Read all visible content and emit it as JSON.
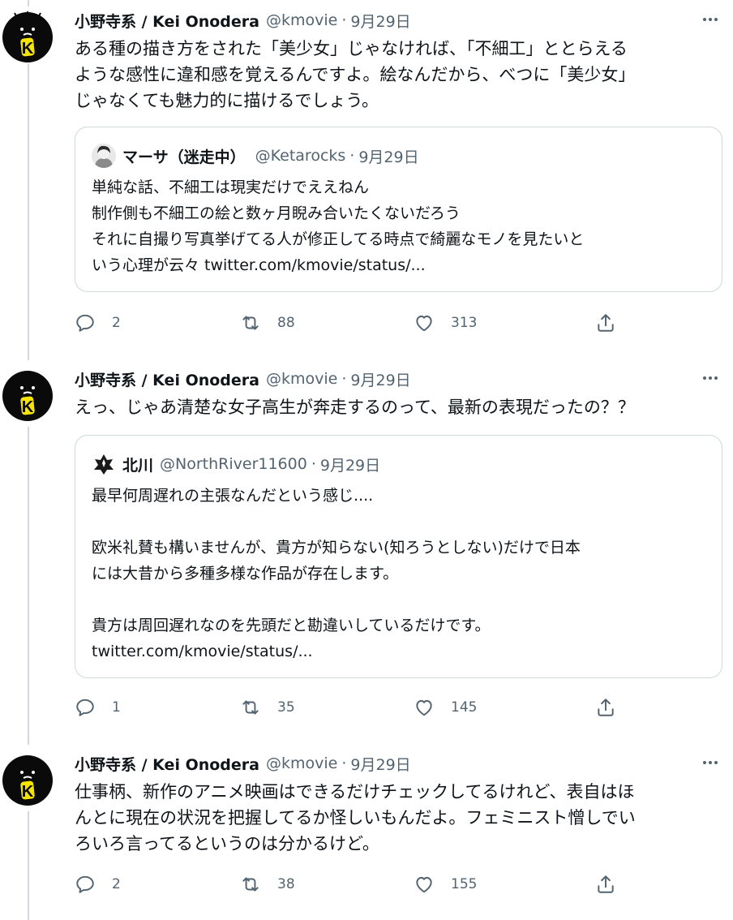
{
  "tweets": [
    {
      "author": "小野寺系 / Kei Onodera",
      "handle": "@kmovie",
      "sep": "·",
      "date": "9月29日",
      "avatar_letter": "K",
      "text": "ある種の描き方をされた「美少女」じゃなければ、「不細工」ととらえる\nような感性に違和感を覚えるんですよ。絵なんだから、べつに「美少女」\nじゃなくても魅力的に描けるでしょう。",
      "quote": {
        "author": "マーサ（迷走中）",
        "handle": "@Ketarocks",
        "sep": "·",
        "date": "9月29日",
        "text": "単純な話、不細工は現実だけでええねん\n制作側も不細工の絵と数ヶ月睨み合いたくないだろう\nそれに自撮り写真挙げてる人が修正してる時点で綺麗なモノを見たいと\nいう心理が云々 twitter.com/kmovie/status/..."
      },
      "replies": "2",
      "retweets": "88",
      "likes": "313"
    },
    {
      "author": "小野寺系 / Kei Onodera",
      "handle": "@kmovie",
      "sep": "·",
      "date": "9月29日",
      "avatar_letter": "K",
      "text": "えっ、じゃあ清楚な女子高生が奔走するのって、最新の表現だったの？？",
      "quote": {
        "author": "北川",
        "handle": "@NorthRiver11600",
        "sep": "·",
        "date": "9月29日",
        "text": "最早何周遅れの主張なんだという感じ....\n\n欧米礼賛も構いませんが、貴方が知らない(知ろうとしない)だけで日本\nには大昔から多種多様な作品が存在します。\n\n貴方は周回遅れなのを先頭だと勘違いしているだけです。\ntwitter.com/kmovie/status/..."
      },
      "replies": "1",
      "retweets": "35",
      "likes": "145"
    },
    {
      "author": "小野寺系 / Kei Onodera",
      "handle": "@kmovie",
      "sep": "·",
      "date": "9月29日",
      "avatar_letter": "K",
      "text": "仕事柄、新作のアニメ映画はできるだけチェックしてるけれど、表自はほ\nんとに現在の状況を把握してるか怪しいもんだよ。フェミニスト憎しでい\nろいろ言ってるというのは分かるけど。",
      "replies": "2",
      "retweets": "38",
      "likes": "155"
    }
  ],
  "icons": {
    "more": "more-dots-icon",
    "reply": "reply-bubble-icon",
    "retweet": "retweet-icon",
    "like": "heart-icon",
    "share": "share-upload-icon"
  },
  "colors": {
    "text": "#0f1419",
    "secondary": "#536471",
    "border": "#cfd9de",
    "avatar_bg": "#0a0a0a",
    "avatar_letter": "#f5e400"
  }
}
